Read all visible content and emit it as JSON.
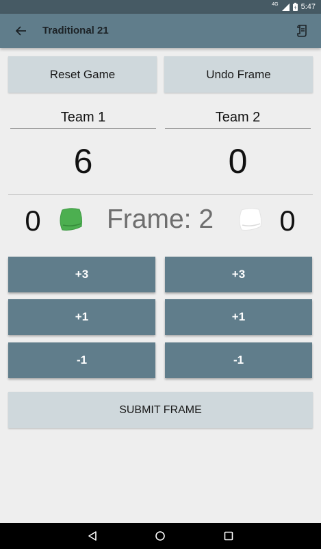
{
  "status_bar": {
    "time": "5:47",
    "network": "4G"
  },
  "app_bar": {
    "title": "Traditional 21"
  },
  "top_buttons": {
    "reset_label": "Reset Game",
    "undo_label": "Undo Frame"
  },
  "teams": [
    {
      "name": "Team 1",
      "score": "6",
      "frame_score": "0",
      "bag_color": "#4caf50"
    },
    {
      "name": "Team 2",
      "score": "0",
      "frame_score": "0",
      "bag_color": "#ffffff"
    }
  ],
  "frame": {
    "label": "Frame: 2"
  },
  "point_buttons": {
    "team1": [
      "+3",
      "+1",
      "-1"
    ],
    "team2": [
      "+3",
      "+1",
      "-1"
    ]
  },
  "submit": {
    "label": "SUBMIT FRAME"
  },
  "colors": {
    "primary": "#607d8b",
    "primary_dark": "#465a64",
    "button_light": "#cfd8dc",
    "background": "#eeeeee"
  }
}
